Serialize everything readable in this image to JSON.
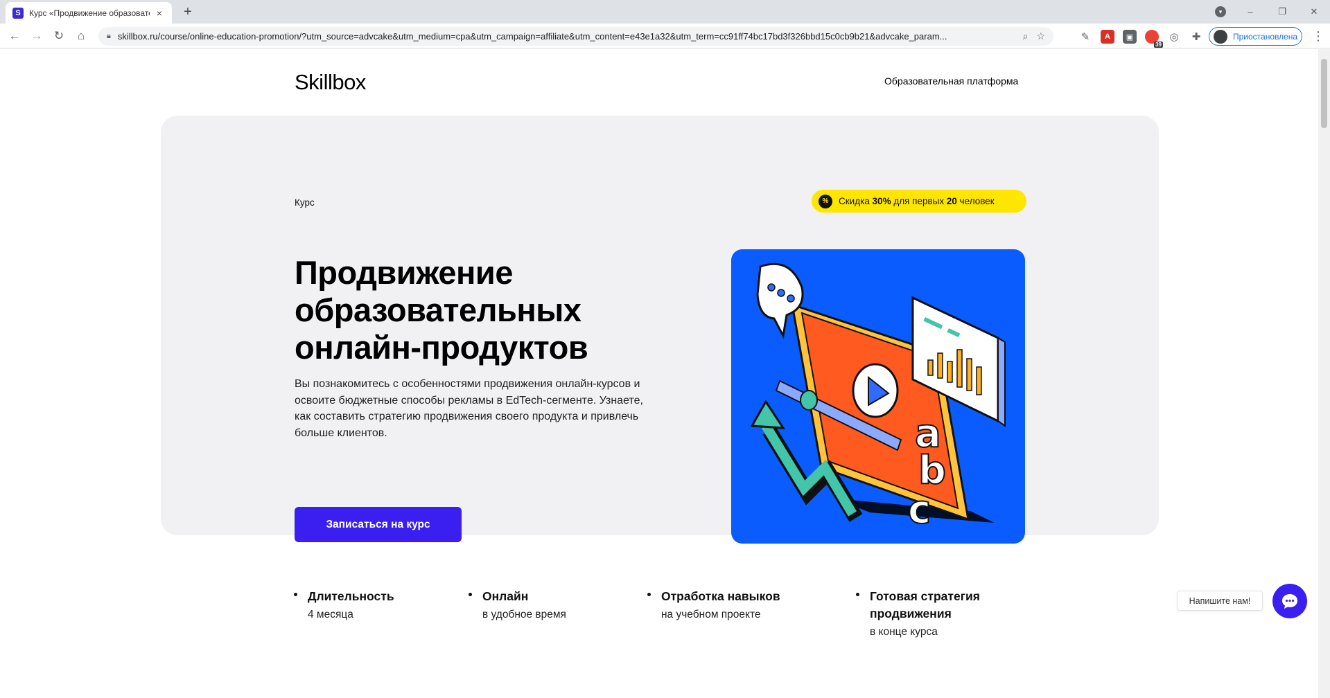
{
  "browser": {
    "tab": {
      "favicon": "S",
      "title": "Курс «Продвижение образовательных",
      "close": "×"
    },
    "new_tab": "+",
    "window_controls": {
      "minimize": "–",
      "maximize": "❐",
      "close": "✕"
    },
    "address": {
      "url": "skillbox.ru/course/online-education-promotion/?utm_source=advcake&utm_medium=cpa&utm_campaign=affiliate&utm_content=e43e1a32&utm_term=cc91ff74bc17bd3f326bbd15c0cb9b21&advcake_param..."
    },
    "extensions": [
      {
        "icon": "eyedropper-icon",
        "color": "#5f6368"
      },
      {
        "icon": "pdf-icon",
        "color": "#d93025"
      },
      {
        "icon": "ext-icon",
        "color": "#5f6368"
      },
      {
        "icon": "red-ext-icon",
        "color": "#ea4335",
        "badge": "39"
      },
      {
        "icon": "circle-ext-icon",
        "color": "#5f6368"
      },
      {
        "icon": "puzzle-icon",
        "color": "#5f6368"
      }
    ],
    "profile": {
      "label": "Приостановлена"
    }
  },
  "page": {
    "logo": "Skillbox",
    "platform_link": "Образовательная платформа",
    "hero": {
      "label": "Курс",
      "discount": {
        "prefix": "Скидка ",
        "percent": "30%",
        "middle": " для первых ",
        "count": "20",
        "suffix": " человек"
      },
      "title": "Продвижение образовательных онлайн-продуктов",
      "description": "Вы познакомитесь с особенностями продвижения онлайн-курсов и освоите бюджетные способы рекламы в EdTech-сегменте. Узнаете, как составить стратегию продвижения своего продукта и привлечь больше клиентов.",
      "cta": "Записаться на курс",
      "illustration": {
        "letters": [
          "a",
          "b",
          "c"
        ]
      }
    },
    "features": [
      {
        "title": "Длительность",
        "sub": "4 месяца"
      },
      {
        "title": "Онлайн",
        "sub": "в удобное время"
      },
      {
        "title": "Отработка навыков",
        "sub": "на учебном проекте"
      },
      {
        "title": "Готовая стратегия продвижения",
        "sub": "в конце курса"
      }
    ],
    "chat": {
      "label": "Напишите нам!"
    }
  },
  "colors": {
    "brand": "#3b1ef0",
    "discount_bg": "#ffe600",
    "hero_bg": "#f1f1f3",
    "illustration_bg": "#0a5cff",
    "screen_orange": "#ff5a1f"
  }
}
